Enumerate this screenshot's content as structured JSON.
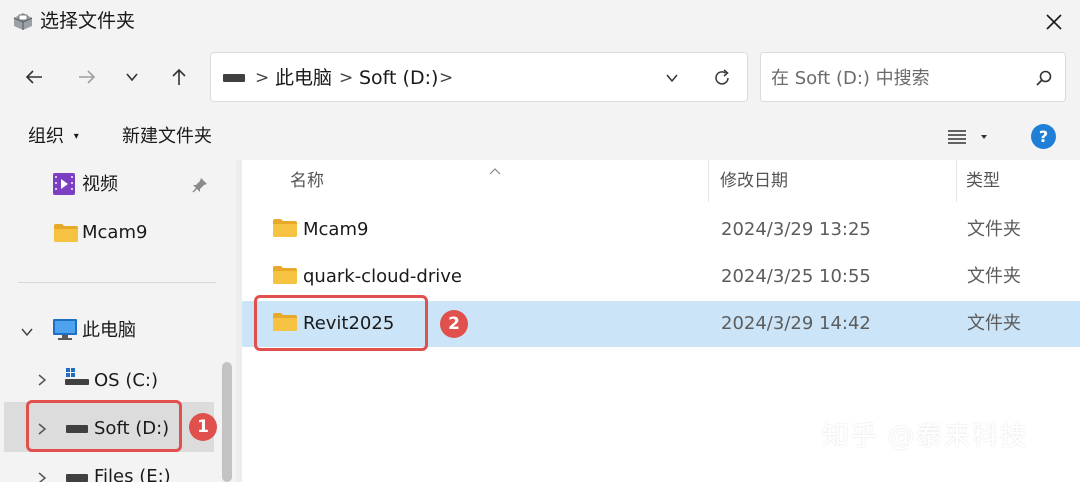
{
  "window": {
    "title": "选择文件夹",
    "icon": "folder-picker-icon"
  },
  "navigation": {
    "back_icon": "arrow-left-icon",
    "forward_icon": "arrow-right-icon",
    "recent_icon": "chevron-down-icon",
    "up_icon": "arrow-up-icon"
  },
  "address": {
    "crumbs": [
      "此电脑",
      "Soft (D:)"
    ],
    "separator": ">"
  },
  "search": {
    "placeholder": "在 Soft (D:) 中搜索"
  },
  "toolbar": {
    "organize_label": "组织",
    "new_folder_label": "新建文件夹",
    "help_label": "?"
  },
  "sidebar": {
    "items": [
      {
        "label": "视频",
        "icon": "video-folder-icon",
        "pinned": true
      },
      {
        "label": "Mcam9",
        "icon": "folder-icon"
      },
      {
        "label": "此电脑",
        "icon": "computer-icon",
        "expanded": true
      },
      {
        "label": "OS (C:)",
        "icon": "os-drive-icon"
      },
      {
        "label": "Soft (D:)",
        "icon": "drive-icon",
        "selected": true
      },
      {
        "label": "Files (E:)",
        "icon": "drive-icon"
      }
    ]
  },
  "file_list": {
    "columns": {
      "name": "名称",
      "date": "修改日期",
      "type": "类型"
    },
    "rows": [
      {
        "name": "Mcam9",
        "date": "2024/3/29 13:25",
        "type": "文件夹"
      },
      {
        "name": "quark-cloud-drive",
        "date": "2024/3/25 10:55",
        "type": "文件夹"
      },
      {
        "name": "Revit2025",
        "date": "2024/3/29 14:42",
        "type": "文件夹",
        "selected": true
      }
    ]
  },
  "annotations": {
    "step1": "1",
    "step2": "2",
    "color": "#e0504c"
  },
  "watermark": "知乎 @泰来科技",
  "colors": {
    "selection": "#cce4f7",
    "folder": "#f5c242",
    "accent": "#1f7fd6"
  }
}
